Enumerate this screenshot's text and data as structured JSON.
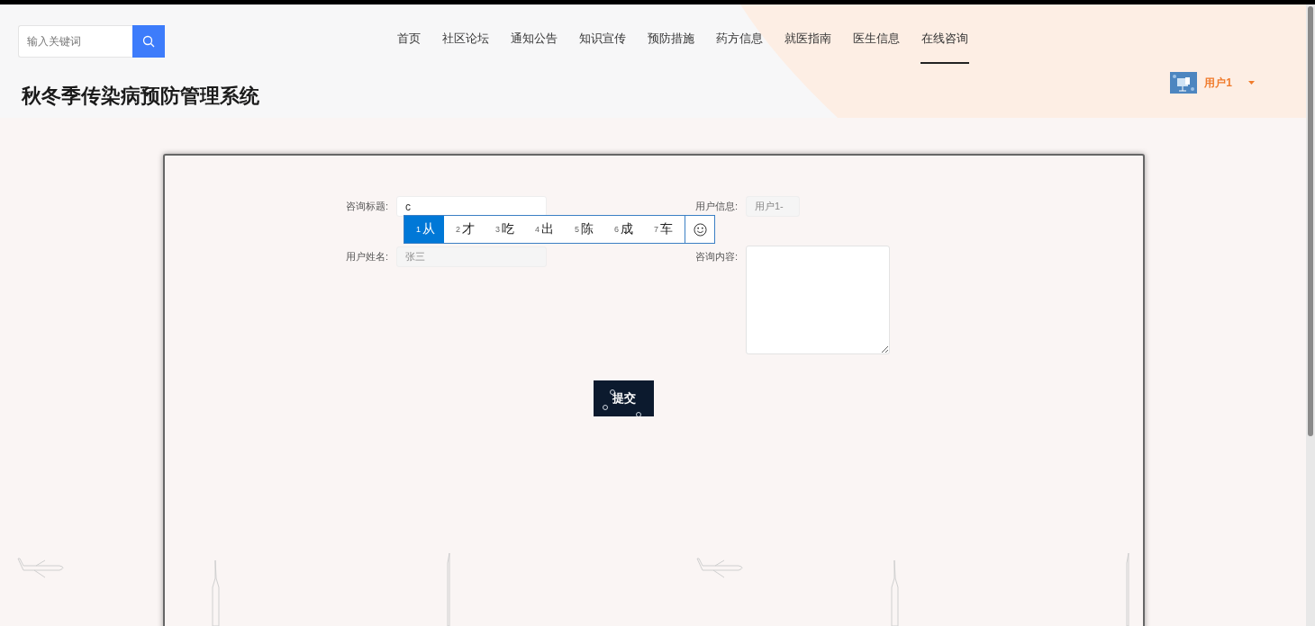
{
  "search": {
    "placeholder": "输入关键词"
  },
  "nav": [
    {
      "label": "首页",
      "selected": false
    },
    {
      "label": "社区论坛",
      "selected": false
    },
    {
      "label": "通知公告",
      "selected": false
    },
    {
      "label": "知识宣传",
      "selected": false
    },
    {
      "label": "预防措施",
      "selected": false
    },
    {
      "label": "药方信息",
      "selected": false
    },
    {
      "label": "就医指南",
      "selected": false
    },
    {
      "label": "医生信息",
      "selected": false
    },
    {
      "label": "在线咨询",
      "selected": true
    }
  ],
  "title": "秋冬季传染病预防管理系统",
  "user": {
    "name": "用户1"
  },
  "form": {
    "fields": [
      {
        "label": "咨询标题:",
        "kind": "input",
        "value": "c",
        "disabled": false
      },
      {
        "label": "用户姓名:",
        "kind": "input",
        "value": "张三",
        "disabled": true
      },
      {
        "label": "用户信息:",
        "kind": "input",
        "value": "用户1-",
        "disabled": true
      },
      {
        "label": "咨询内容:",
        "kind": "textarea"
      }
    ],
    "submit": "提交"
  },
  "ime": {
    "candidates": [
      {
        "index": "1",
        "text": "从",
        "selected": true
      },
      {
        "index": "2",
        "text": "才",
        "selected": false
      },
      {
        "index": "3",
        "text": "吃",
        "selected": false
      },
      {
        "index": "4",
        "text": "出",
        "selected": false
      },
      {
        "index": "5",
        "text": "陈",
        "selected": false
      },
      {
        "index": "6",
        "text": "成",
        "selected": false
      },
      {
        "index": "7",
        "text": "车",
        "selected": false
      }
    ]
  }
}
